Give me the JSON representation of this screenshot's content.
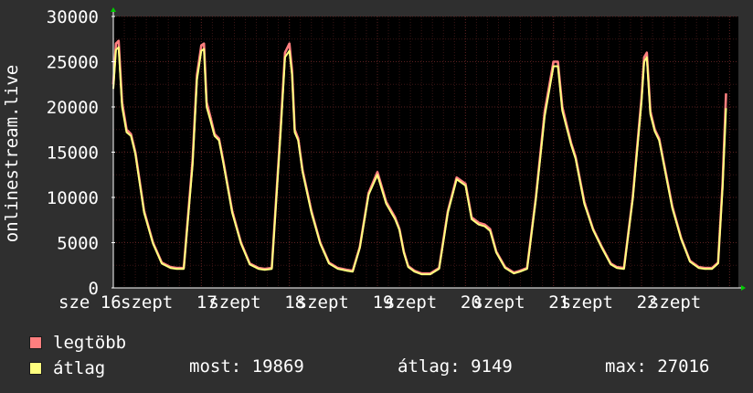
{
  "chart_data": {
    "type": "line",
    "ylabel": "onlinestream.live",
    "ylim": [
      0,
      30000
    ],
    "yticks": [
      0,
      5000,
      10000,
      15000,
      20000,
      25000,
      30000
    ],
    "ytick_labels": [
      "0",
      "5000",
      "10000",
      "15000",
      "20000",
      "25000",
      "30000"
    ],
    "xlim": [
      0,
      7.1
    ],
    "xticks": [
      {
        "pos": 0.0,
        "label": "sze 16"
      },
      {
        "pos": 0.38,
        "label": "szept"
      },
      {
        "pos": 1.0,
        "label": "17"
      },
      {
        "pos": 1.38,
        "label": "szept"
      },
      {
        "pos": 2.0,
        "label": "18"
      },
      {
        "pos": 2.38,
        "label": "szept"
      },
      {
        "pos": 3.0,
        "label": "19"
      },
      {
        "pos": 3.38,
        "label": "szept"
      },
      {
        "pos": 4.0,
        "label": "20"
      },
      {
        "pos": 4.38,
        "label": "szept"
      },
      {
        "pos": 5.0,
        "label": "21"
      },
      {
        "pos": 5.38,
        "label": "szept"
      },
      {
        "pos": 6.0,
        "label": "22"
      },
      {
        "pos": 6.38,
        "label": "szept"
      }
    ],
    "grid": true,
    "background": "#000000",
    "grid_color": "#5a2020",
    "series": [
      {
        "name": "legtöbb",
        "color": "#ff7f7f",
        "x": [
          0.0,
          0.03,
          0.06,
          0.1,
          0.15,
          0.2,
          0.25,
          0.35,
          0.45,
          0.55,
          0.65,
          0.72,
          0.8,
          0.9,
          0.95,
          1.0,
          1.03,
          1.06,
          1.1,
          1.15,
          1.2,
          1.25,
          1.35,
          1.45,
          1.55,
          1.65,
          1.72,
          1.8,
          1.9,
          1.95,
          2.0,
          2.03,
          2.06,
          2.1,
          2.15,
          2.25,
          2.35,
          2.45,
          2.55,
          2.65,
          2.72,
          2.8,
          2.9,
          3.0,
          3.1,
          3.2,
          3.25,
          3.3,
          3.35,
          3.42,
          3.5,
          3.6,
          3.7,
          3.8,
          3.9,
          4.0,
          4.07,
          4.15,
          4.22,
          4.28,
          4.35,
          4.45,
          4.55,
          4.62,
          4.7,
          4.8,
          4.9,
          5.0,
          5.05,
          5.1,
          5.15,
          5.2,
          5.25,
          5.35,
          5.45,
          5.55,
          5.65,
          5.72,
          5.8,
          5.9,
          6.0,
          6.03,
          6.06,
          6.1,
          6.15,
          6.2,
          6.25,
          6.35,
          6.45,
          6.55,
          6.65,
          6.72,
          6.8,
          6.87,
          6.92,
          6.96
        ],
        "y": [
          22500,
          27000,
          27300,
          20500,
          17500,
          17000,
          15000,
          8500,
          5000,
          2800,
          2300,
          2200,
          2200,
          14000,
          23500,
          26800,
          27000,
          20500,
          19000,
          17000,
          16500,
          14000,
          8500,
          5000,
          2700,
          2200,
          2100,
          2200,
          17500,
          26000,
          27000,
          24000,
          17500,
          16500,
          13000,
          8500,
          5000,
          2800,
          2200,
          2000,
          1900,
          4500,
          10500,
          12800,
          9500,
          7800,
          6500,
          4000,
          2400,
          1900,
          1600,
          1600,
          2200,
          8500,
          12200,
          11500,
          7800,
          7200,
          7000,
          6500,
          4000,
          2300,
          1700,
          1900,
          2200,
          10000,
          19500,
          25000,
          25000,
          20000,
          18000,
          16000,
          14500,
          9500,
          6500,
          4500,
          2700,
          2300,
          2200,
          10000,
          21000,
          25500,
          26000,
          19500,
          17500,
          16500,
          14000,
          9000,
          5500,
          3000,
          2300,
          2200,
          2200,
          2800,
          11500,
          21500
        ]
      },
      {
        "name": "átlag",
        "color": "#ffff7f",
        "x": [
          0.0,
          0.03,
          0.06,
          0.1,
          0.15,
          0.2,
          0.25,
          0.35,
          0.45,
          0.55,
          0.65,
          0.72,
          0.8,
          0.9,
          0.95,
          1.0,
          1.03,
          1.06,
          1.1,
          1.15,
          1.2,
          1.25,
          1.35,
          1.45,
          1.55,
          1.65,
          1.72,
          1.8,
          1.9,
          1.95,
          2.0,
          2.03,
          2.06,
          2.1,
          2.15,
          2.25,
          2.35,
          2.45,
          2.55,
          2.65,
          2.72,
          2.8,
          2.9,
          3.0,
          3.1,
          3.2,
          3.25,
          3.3,
          3.35,
          3.42,
          3.5,
          3.6,
          3.7,
          3.8,
          3.9,
          4.0,
          4.07,
          4.15,
          4.22,
          4.28,
          4.35,
          4.45,
          4.55,
          4.62,
          4.7,
          4.8,
          4.9,
          5.0,
          5.05,
          5.1,
          5.15,
          5.2,
          5.25,
          5.35,
          5.45,
          5.55,
          5.65,
          5.72,
          5.8,
          5.9,
          6.0,
          6.03,
          6.06,
          6.1,
          6.15,
          6.2,
          6.25,
          6.35,
          6.45,
          6.55,
          6.65,
          6.72,
          6.8,
          6.87,
          6.92,
          6.96
        ],
        "y": [
          22000,
          26300,
          26600,
          20000,
          17200,
          16800,
          14800,
          8300,
          4900,
          2700,
          2200,
          2100,
          2100,
          13500,
          23000,
          26200,
          26400,
          20000,
          18600,
          16800,
          16300,
          13800,
          8300,
          4900,
          2600,
          2100,
          2000,
          2100,
          17000,
          25500,
          26200,
          23500,
          17200,
          16300,
          12800,
          8300,
          4900,
          2700,
          2100,
          1900,
          1800,
          4400,
          10300,
          12500,
          9300,
          7600,
          6400,
          3900,
          2300,
          1800,
          1500,
          1500,
          2100,
          8300,
          12000,
          11300,
          7600,
          7000,
          6800,
          6300,
          3900,
          2200,
          1600,
          1800,
          2100,
          9800,
          19000,
          24500,
          24500,
          19600,
          17700,
          15800,
          14300,
          9300,
          6400,
          4400,
          2600,
          2200,
          2100,
          9800,
          20500,
          25000,
          25500,
          19200,
          17300,
          16300,
          13800,
          8800,
          5400,
          2900,
          2200,
          2100,
          2100,
          2700,
          11000,
          19869
        ]
      }
    ]
  },
  "legend": {
    "items": [
      {
        "label": "legtöbb",
        "color": "#ff7f7f"
      },
      {
        "label": "átlag",
        "color": "#ffff7f"
      }
    ],
    "stats": {
      "current": "most: 19869",
      "average": "átlag: 9149",
      "max": "max: 27016"
    }
  }
}
